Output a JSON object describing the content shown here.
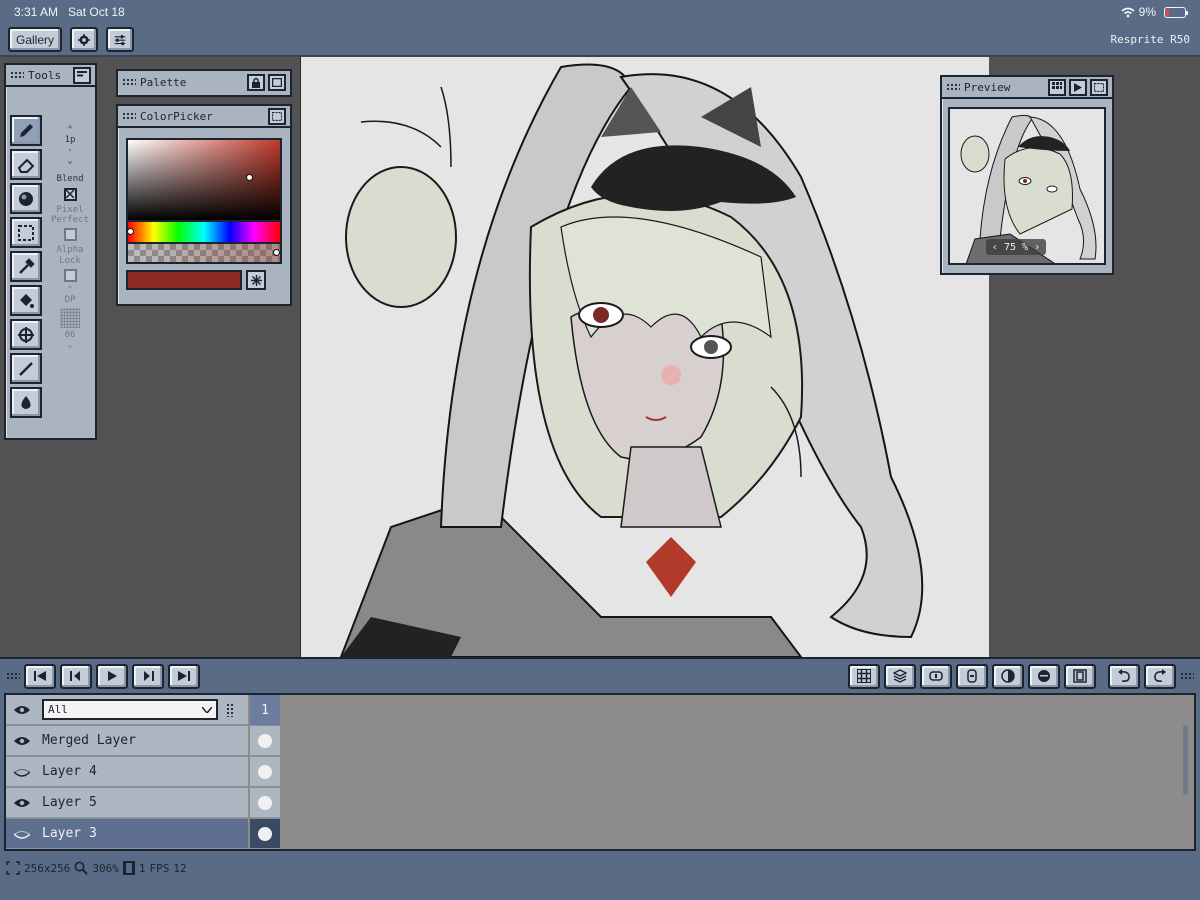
{
  "status_bar": {
    "time": "3:31 AM",
    "date": "Sat Oct 18",
    "battery": "9%"
  },
  "toolbar": {
    "gallery_label": "Gallery",
    "settings_icon": "gear-icon",
    "adjust_icon": "sliders-icon",
    "app_version": "Resprite R50"
  },
  "tools_panel": {
    "title": "Tools",
    "tools": [
      "pencil-icon",
      "eraser-icon",
      "shade-icon",
      "selection-icon",
      "eyedropper-icon",
      "fill-bucket-icon",
      "move-icon",
      "line-icon",
      "smudge-icon"
    ],
    "brush_size": "1p",
    "blend_label": "Blend",
    "pixel_perfect_label": "Pixel Perfect",
    "alpha_lock_label": "Alpha Lock",
    "dither_label": "DP",
    "dither_value": "06"
  },
  "palette_panel": {
    "title": "Palette"
  },
  "colorpicker_panel": {
    "title": "ColorPicker",
    "hue_color": "#c0392b",
    "current_color": "#8e2a22",
    "saturation": 0.8,
    "value": 0.52,
    "hue_position": 0.0,
    "alpha": 1.0
  },
  "preview_panel": {
    "title": "Preview",
    "zoom": "75 %"
  },
  "timeline": {
    "filter_value": "All",
    "frame_number": "1",
    "layers": [
      {
        "name": "Merged Layer",
        "visible": true,
        "selected": false
      },
      {
        "name": "Layer 4",
        "visible": false,
        "selected": false
      },
      {
        "name": "Layer 5",
        "visible": true,
        "selected": false
      },
      {
        "name": "Layer 3",
        "visible": false,
        "selected": true
      }
    ]
  },
  "canvas_status": {
    "size": "256x256",
    "zoom": "306%",
    "frames": "1",
    "fps_label": "FPS",
    "fps_value": "12"
  },
  "colors": {
    "ui_blue": "#5a6b85",
    "panel": "#aab3c0",
    "canvas_bg": "#525252",
    "art_bg": "#e5e5e5"
  }
}
